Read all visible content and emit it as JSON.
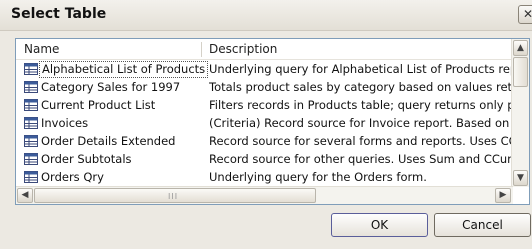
{
  "window": {
    "title": "Select Table",
    "close_glyph": "✕"
  },
  "columns": {
    "name": "Name",
    "description": "Description"
  },
  "rows": [
    {
      "name": "Alphabetical List of Products",
      "description": "Underlying query for Alphabetical List of Products report.",
      "icon": "table-icon",
      "selected": true
    },
    {
      "name": "Category Sales for 1997",
      "description": "Totals product sales by category based on values returned",
      "icon": "table-icon"
    },
    {
      "name": "Current Product List",
      "description": "Filters records in Products table; query returns only produ",
      "icon": "table-icon"
    },
    {
      "name": "Invoices",
      "description": "(Criteria) Record source for Invoice report. Based on six ta",
      "icon": "table-icon"
    },
    {
      "name": "Order Details Extended",
      "description": "Record source for several forms and reports. Uses CCur fu",
      "icon": "table-icon"
    },
    {
      "name": "Order Subtotals",
      "description": "Record source for other queries. Uses Sum and CCur funct",
      "icon": "table-icon"
    },
    {
      "name": "Orders Qry",
      "description": "Underlying query for the Orders form.",
      "icon": "table-icon"
    }
  ],
  "scrollbars": {
    "up": "▲",
    "down": "▼",
    "left": "◀",
    "right": "▶",
    "grip": "III"
  },
  "buttons": {
    "ok": "OK",
    "cancel": "Cancel"
  }
}
